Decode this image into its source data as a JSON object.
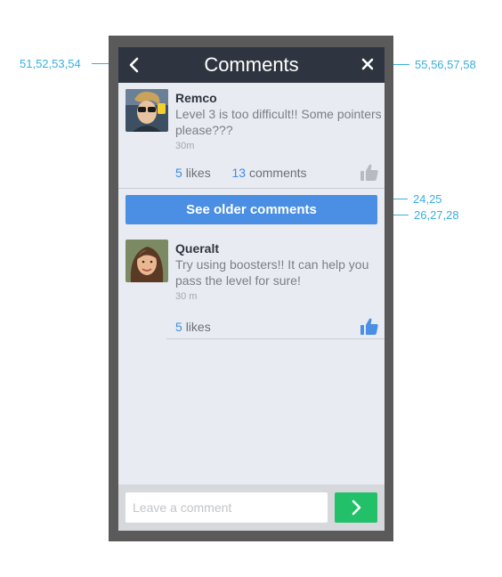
{
  "annotations": {
    "left_nav": "51,52,53,54",
    "right_nav": "55,56,57,58",
    "button_top": "24,25",
    "button_text": "26,27,28"
  },
  "header": {
    "title": "Comments",
    "back_icon": "chevron-left-icon",
    "close_icon": "close-icon"
  },
  "comments": [
    {
      "author": "Remco",
      "text": "Level 3 is too difficult!! Some pointers please???",
      "time": "30m",
      "likes_count": "5",
      "likes_label": "likes",
      "comments_count": "13",
      "comments_label": "comments",
      "liked": false
    },
    {
      "author": "Queralt",
      "text": "Try using boosters!! It can help you pass the level for sure!",
      "time": "30 m",
      "likes_count": "5",
      "likes_label": "likes",
      "liked": true
    }
  ],
  "older_button": {
    "label": "See older comments"
  },
  "composer": {
    "placeholder": "Leave a comment",
    "value": "",
    "send_icon": "chevron-right-icon"
  },
  "colors": {
    "nav": "#2f3540",
    "accent": "#4a8fe3",
    "send": "#23c06a",
    "thumb_inactive": "#b6bac1",
    "annotation": "#3aaee0"
  }
}
